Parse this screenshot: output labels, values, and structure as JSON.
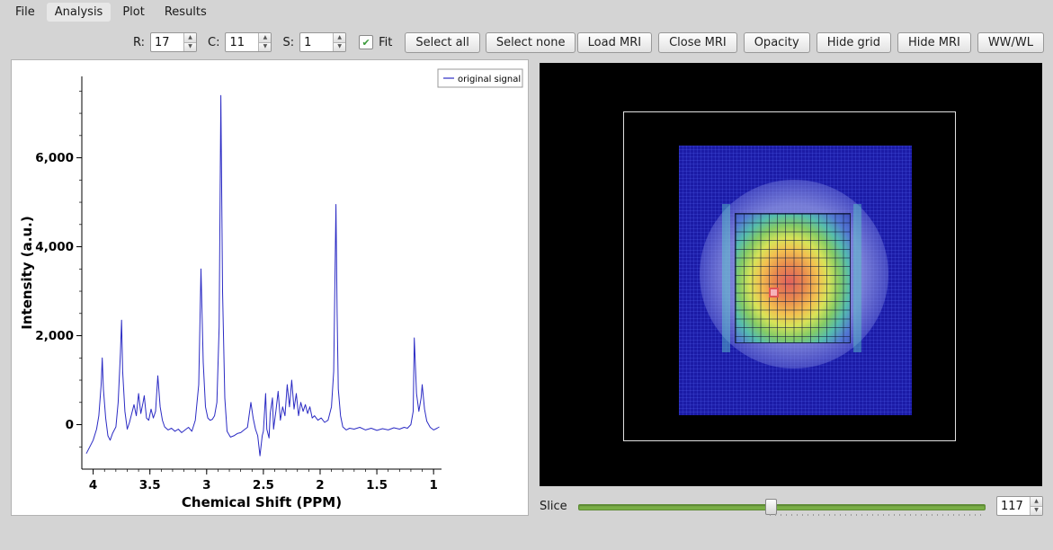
{
  "menu": {
    "items": [
      "File",
      "Analysis",
      "Plot",
      "Results"
    ]
  },
  "toolbar": {
    "r_label": "R:",
    "r_value": "17",
    "c_label": "C:",
    "c_value": "11",
    "s_label": "S:",
    "s_value": "1",
    "fit_label": "Fit",
    "select_all": "Select all",
    "select_none": "Select none",
    "right_buttons": [
      "Load MRI",
      "Close MRI",
      "Opacity",
      "Hide grid",
      "Hide MRI",
      "WW/WL"
    ]
  },
  "icons": {
    "spin_up": "▲",
    "spin_down": "▼",
    "check": "✔"
  },
  "chart_data": {
    "type": "line",
    "title": "",
    "xlabel": "Chemical Shift (PPM)",
    "ylabel": "Intensity (a.u.)",
    "xlim": [
      4.1,
      0.93
    ],
    "x_axis_reversed": true,
    "ylim": [
      -1000,
      7830
    ],
    "x_ticks": [
      4,
      3.5,
      3,
      2.5,
      2,
      1.5,
      1
    ],
    "x_tick_labels": [
      "4",
      "3.5",
      "3",
      "2.5",
      "2",
      "1.5",
      "1"
    ],
    "y_ticks": [
      0,
      2000,
      4000,
      6000
    ],
    "y_tick_labels": [
      "0",
      "2,000",
      "4,000",
      "6,000"
    ],
    "grid": false,
    "legend": [
      "original signal"
    ],
    "legend_position": "upper right",
    "line_color": "#2b2bc4",
    "series": [
      {
        "name": "original signal",
        "points": [
          [
            4.06,
            -650
          ],
          [
            4.03,
            -500
          ],
          [
            4.0,
            -350
          ],
          [
            3.97,
            -100
          ],
          [
            3.95,
            200
          ],
          [
            3.93,
            900
          ],
          [
            3.92,
            1500
          ],
          [
            3.91,
            800
          ],
          [
            3.89,
            150
          ],
          [
            3.87,
            -250
          ],
          [
            3.85,
            -350
          ],
          [
            3.83,
            -200
          ],
          [
            3.8,
            -50
          ],
          [
            3.78,
            500
          ],
          [
            3.76,
            1600
          ],
          [
            3.75,
            2350
          ],
          [
            3.74,
            1200
          ],
          [
            3.72,
            300
          ],
          [
            3.7,
            -100
          ],
          [
            3.68,
            50
          ],
          [
            3.66,
            250
          ],
          [
            3.64,
            450
          ],
          [
            3.62,
            200
          ],
          [
            3.6,
            700
          ],
          [
            3.58,
            250
          ],
          [
            3.56,
            500
          ],
          [
            3.55,
            650
          ],
          [
            3.53,
            150
          ],
          [
            3.51,
            100
          ],
          [
            3.49,
            350
          ],
          [
            3.47,
            150
          ],
          [
            3.45,
            300
          ],
          [
            3.43,
            1100
          ],
          [
            3.41,
            400
          ],
          [
            3.39,
            100
          ],
          [
            3.37,
            -50
          ],
          [
            3.34,
            -120
          ],
          [
            3.31,
            -80
          ],
          [
            3.28,
            -150
          ],
          [
            3.25,
            -100
          ],
          [
            3.22,
            -180
          ],
          [
            3.19,
            -120
          ],
          [
            3.16,
            -60
          ],
          [
            3.13,
            -150
          ],
          [
            3.1,
            100
          ],
          [
            3.07,
            900
          ],
          [
            3.05,
            3500
          ],
          [
            3.03,
            1400
          ],
          [
            3.01,
            400
          ],
          [
            2.99,
            150
          ],
          [
            2.97,
            100
          ],
          [
            2.95,
            120
          ],
          [
            2.93,
            200
          ],
          [
            2.91,
            500
          ],
          [
            2.89,
            2200
          ],
          [
            2.875,
            7400
          ],
          [
            2.86,
            3000
          ],
          [
            2.84,
            600
          ],
          [
            2.82,
            -150
          ],
          [
            2.79,
            -280
          ],
          [
            2.76,
            -250
          ],
          [
            2.73,
            -200
          ],
          [
            2.7,
            -180
          ],
          [
            2.67,
            -120
          ],
          [
            2.64,
            -60
          ],
          [
            2.61,
            500
          ],
          [
            2.59,
            150
          ],
          [
            2.57,
            -100
          ],
          [
            2.55,
            -250
          ],
          [
            2.53,
            -700
          ],
          [
            2.51,
            -250
          ],
          [
            2.5,
            -150
          ],
          [
            2.48,
            700
          ],
          [
            2.47,
            -100
          ],
          [
            2.45,
            -300
          ],
          [
            2.44,
            250
          ],
          [
            2.42,
            600
          ],
          [
            2.41,
            -100
          ],
          [
            2.39,
            300
          ],
          [
            2.37,
            750
          ],
          [
            2.35,
            100
          ],
          [
            2.33,
            400
          ],
          [
            2.31,
            200
          ],
          [
            2.29,
            900
          ],
          [
            2.27,
            400
          ],
          [
            2.25,
            1000
          ],
          [
            2.23,
            350
          ],
          [
            2.21,
            700
          ],
          [
            2.19,
            200
          ],
          [
            2.17,
            500
          ],
          [
            2.15,
            300
          ],
          [
            2.13,
            450
          ],
          [
            2.11,
            250
          ],
          [
            2.09,
            400
          ],
          [
            2.07,
            150
          ],
          [
            2.05,
            200
          ],
          [
            2.02,
            100
          ],
          [
            1.99,
            150
          ],
          [
            1.96,
            50
          ],
          [
            1.93,
            100
          ],
          [
            1.9,
            400
          ],
          [
            1.88,
            1200
          ],
          [
            1.86,
            4950
          ],
          [
            1.85,
            2500
          ],
          [
            1.84,
            800
          ],
          [
            1.82,
            200
          ],
          [
            1.8,
            -50
          ],
          [
            1.77,
            -120
          ],
          [
            1.74,
            -80
          ],
          [
            1.7,
            -100
          ],
          [
            1.65,
            -60
          ],
          [
            1.6,
            -120
          ],
          [
            1.55,
            -80
          ],
          [
            1.5,
            -130
          ],
          [
            1.45,
            -90
          ],
          [
            1.4,
            -120
          ],
          [
            1.35,
            -70
          ],
          [
            1.3,
            -100
          ],
          [
            1.26,
            -60
          ],
          [
            1.23,
            -80
          ],
          [
            1.2,
            0
          ],
          [
            1.18,
            300
          ],
          [
            1.17,
            1950
          ],
          [
            1.15,
            700
          ],
          [
            1.13,
            300
          ],
          [
            1.11,
            600
          ],
          [
            1.1,
            900
          ],
          [
            1.08,
            350
          ],
          [
            1.06,
            80
          ],
          [
            1.03,
            -60
          ],
          [
            1.0,
            -120
          ],
          [
            0.97,
            -80
          ],
          [
            0.95,
            -50
          ]
        ]
      }
    ]
  },
  "mri": {
    "slice_label": "Slice",
    "slice_value": "117",
    "slider_fraction": 0.47
  }
}
